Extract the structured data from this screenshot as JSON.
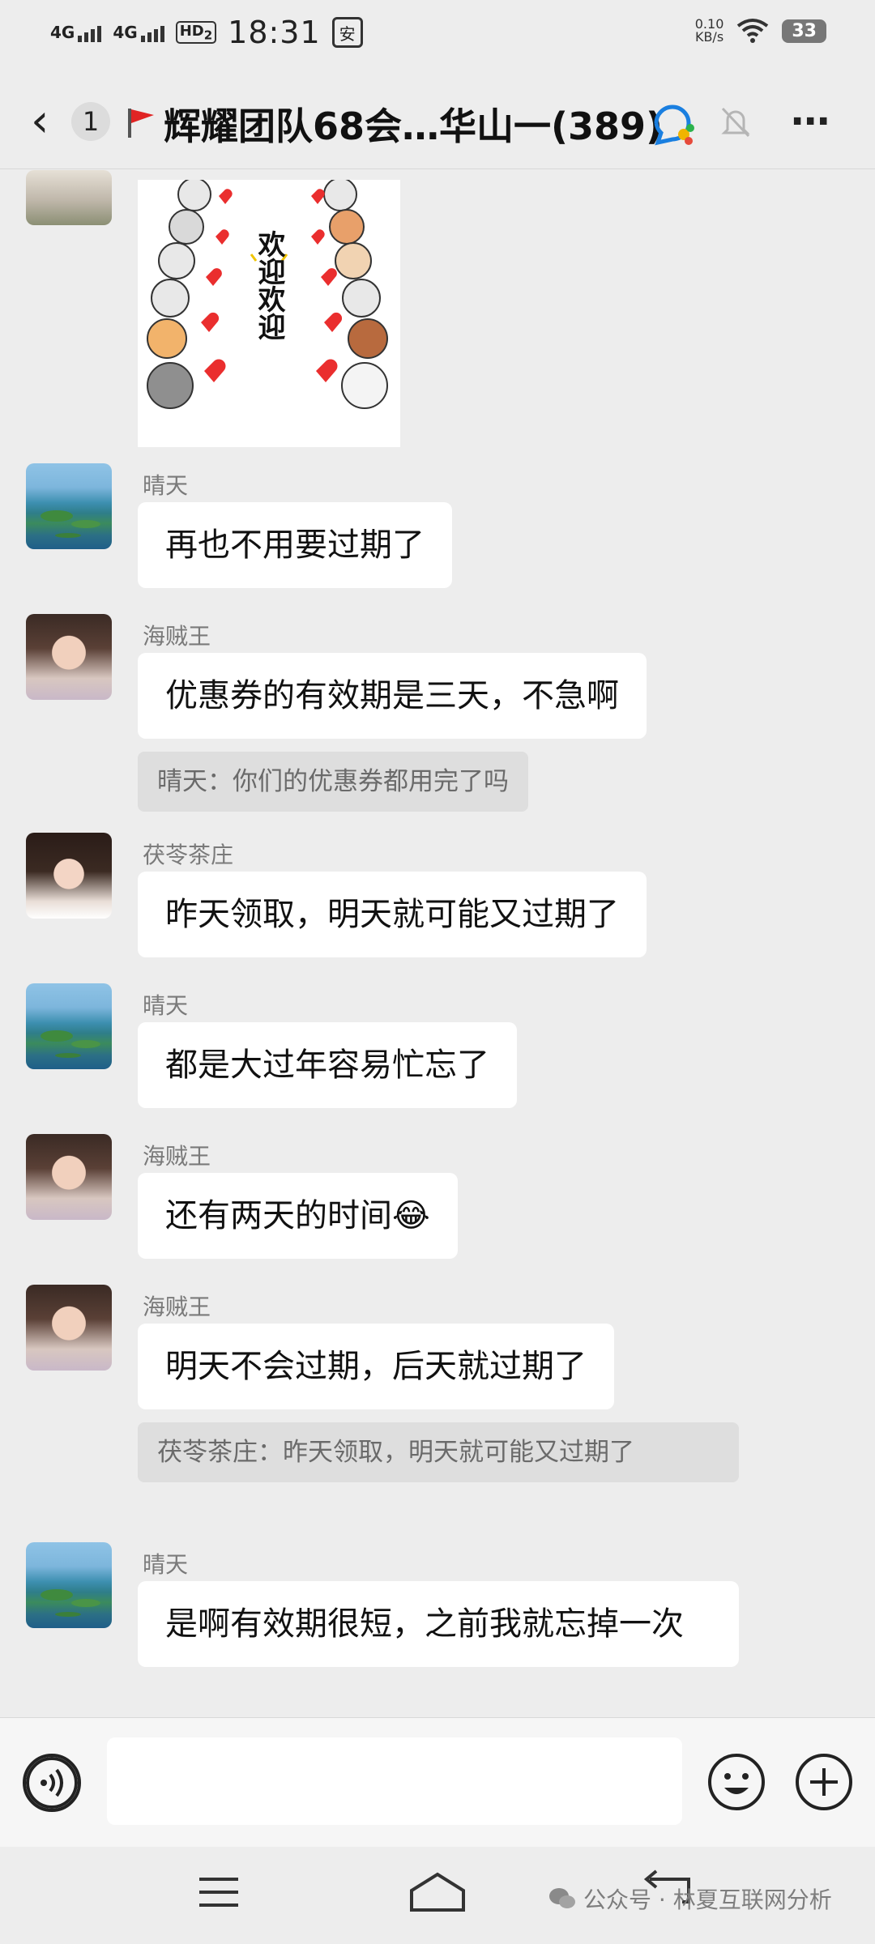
{
  "status_bar": {
    "signal1": "4G",
    "signal2": "4G",
    "hd": "HD",
    "hd_sub": "2",
    "time": "18:31",
    "app_badge": "安",
    "net_speed": "0.10",
    "net_unit": "KB/s",
    "battery": "33"
  },
  "header": {
    "unread_count": "1",
    "title": "辉耀团队68会…华山一(389)"
  },
  "messages": [
    {
      "sender": "晴天",
      "text": "再也不用要过期了"
    },
    {
      "sender": "海贼王",
      "text": "优惠券的有效期是三天，不急啊",
      "quote": "晴天：你们的优惠券都用完了吗"
    },
    {
      "sender": "茯苓茶庄",
      "text": "昨天领取，明天就可能又过期了"
    },
    {
      "sender": "晴天",
      "text": "都是大过年容易忙忘了"
    },
    {
      "sender": "海贼王",
      "text": "还有两天的时间😂"
    },
    {
      "sender": "海贼王",
      "text": "明天不会过期，后天就过期了",
      "quote": "茯苓茶庄：昨天领取，明天就可能又过期了"
    },
    {
      "sender": "晴天",
      "text": "是啊有效期很短，之前我就忘掉一次"
    }
  ],
  "sticker": {
    "text": "欢迎欢迎"
  },
  "watermark": {
    "text": "公众号 · 林夏互联网分析"
  }
}
